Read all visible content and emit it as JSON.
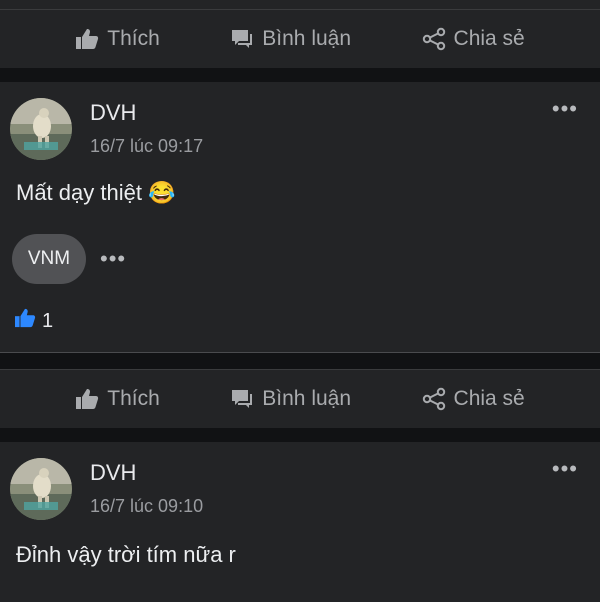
{
  "actions": {
    "like": "Thích",
    "comment": "Bình luận",
    "share": "Chia sẻ"
  },
  "colors": {
    "background": "#111214",
    "card": "#232426",
    "accent_blue": "#2d88ff",
    "chip": "#515255"
  },
  "posts": [
    {
      "author": "DVH",
      "timestamp": "16/7 lúc 09:17",
      "text": "Mất dạy thiệt",
      "emoji": "😂",
      "chip": "VNM",
      "like_count": "1"
    },
    {
      "author": "DVH",
      "timestamp": "16/7 lúc 09:10",
      "text": "Đỉnh vậy trời tím nữa r"
    }
  ],
  "icons": [
    "thumbs-up-icon",
    "comment-icon",
    "share-icon",
    "more-icon",
    "laughing-emoji-icon"
  ]
}
